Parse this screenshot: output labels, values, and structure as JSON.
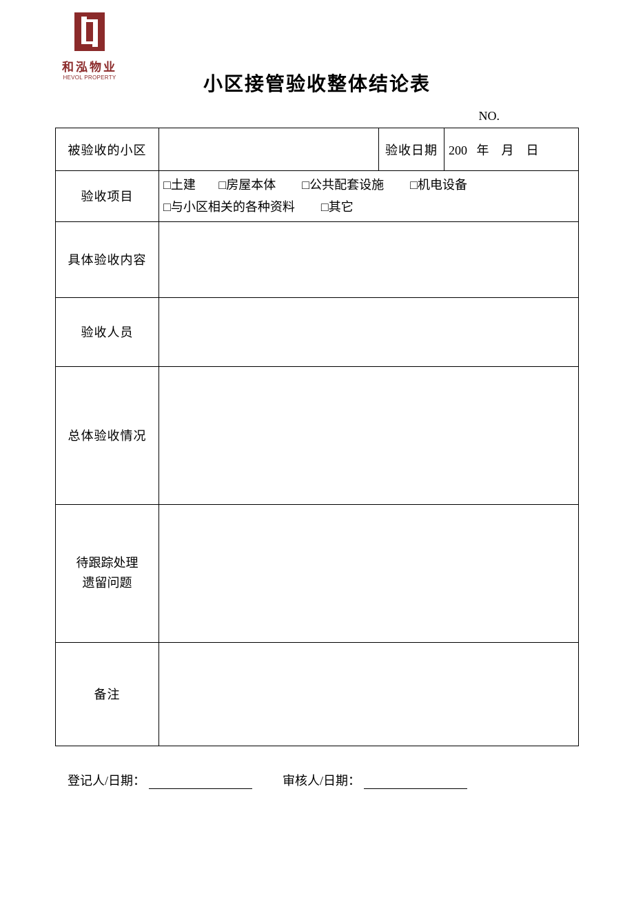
{
  "logo": {
    "cn": "和泓物业",
    "en": "HEVOL PROPERTY"
  },
  "title": "小区接管验收整体结论表",
  "no_label": "NO.",
  "rows": {
    "r1_label": "被验收的小区",
    "r1_date_label": "验收日期",
    "r1_date_value": "200   年    月    日",
    "r2_label": "验收项目",
    "r2_opts": {
      "a": "□土建",
      "b": "□房屋本体",
      "c": "□公共配套设施",
      "d": "□机电设备",
      "e": "□与小区相关的各种资料",
      "f": "□其它"
    },
    "r3_label": "具体验收内容",
    "r4_label": "验收人员",
    "r5_label": "总体验收情况",
    "r6_label_line1": "待跟踪处理",
    "r6_label_line2": "遗留问题",
    "r7_label": "备注"
  },
  "footer": {
    "registrar": "登记人/日期：",
    "reviewer": "审核人/日期："
  }
}
